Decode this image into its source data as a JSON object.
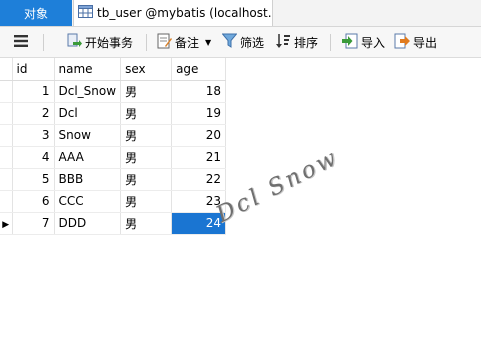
{
  "tabs": {
    "objects_label": "对象",
    "table_tab_label": "tb_user @mybatis (localhost..."
  },
  "toolbar": {
    "begin_transaction": "开始事务",
    "note": "备注",
    "filter": "筛选",
    "sort": "排序",
    "import": "导入",
    "export": "导出"
  },
  "grid": {
    "columns": [
      "id",
      "name",
      "sex",
      "age"
    ],
    "rows": [
      {
        "id": "1",
        "name": "Dcl_Snow",
        "sex": "男",
        "age": "18"
      },
      {
        "id": "2",
        "name": "Dcl",
        "sex": "男",
        "age": "19"
      },
      {
        "id": "3",
        "name": "Snow",
        "sex": "男",
        "age": "20"
      },
      {
        "id": "4",
        "name": "AAA",
        "sex": "男",
        "age": "21"
      },
      {
        "id": "5",
        "name": "BBB",
        "sex": "男",
        "age": "22"
      },
      {
        "id": "6",
        "name": "CCC",
        "sex": "男",
        "age": "23"
      },
      {
        "id": "7",
        "name": "DDD",
        "sex": "男",
        "age": "24"
      }
    ],
    "current_row_marker": "▶"
  },
  "watermark": "Dcl Snow",
  "colors": {
    "accent": "#1e7fd9",
    "selected_cell": "#1a75d2"
  }
}
